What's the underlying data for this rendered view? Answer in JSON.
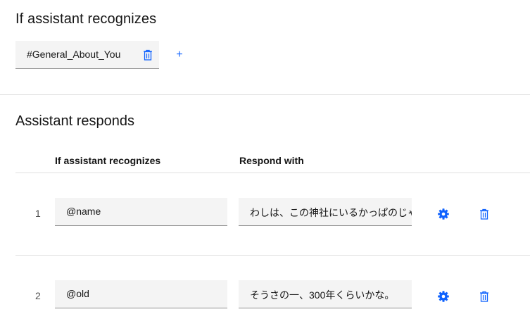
{
  "condition": {
    "title": "If assistant recognizes",
    "intent_value": "#General_About_You",
    "delete_icon": "trash-icon",
    "add_icon": "plus-icon",
    "add_symbol": "+"
  },
  "responses": {
    "title": "Assistant responds",
    "columns": [
      "If assistant recognizes",
      "Respond with"
    ],
    "rows": [
      {
        "number": "1",
        "condition": "@name",
        "response": "わしは、この神社にいるかっぱのじゃ",
        "settings_icon": "gear-icon",
        "delete_icon": "trash-icon"
      },
      {
        "number": "2",
        "condition": "@old",
        "response": "そうさの一、300年くらいかな。",
        "settings_icon": "gear-icon",
        "delete_icon": "trash-icon"
      }
    ]
  },
  "colors": {
    "accent": "#0f62fe",
    "field_bg": "#f4f4f4",
    "divider": "#e0e0e0"
  }
}
